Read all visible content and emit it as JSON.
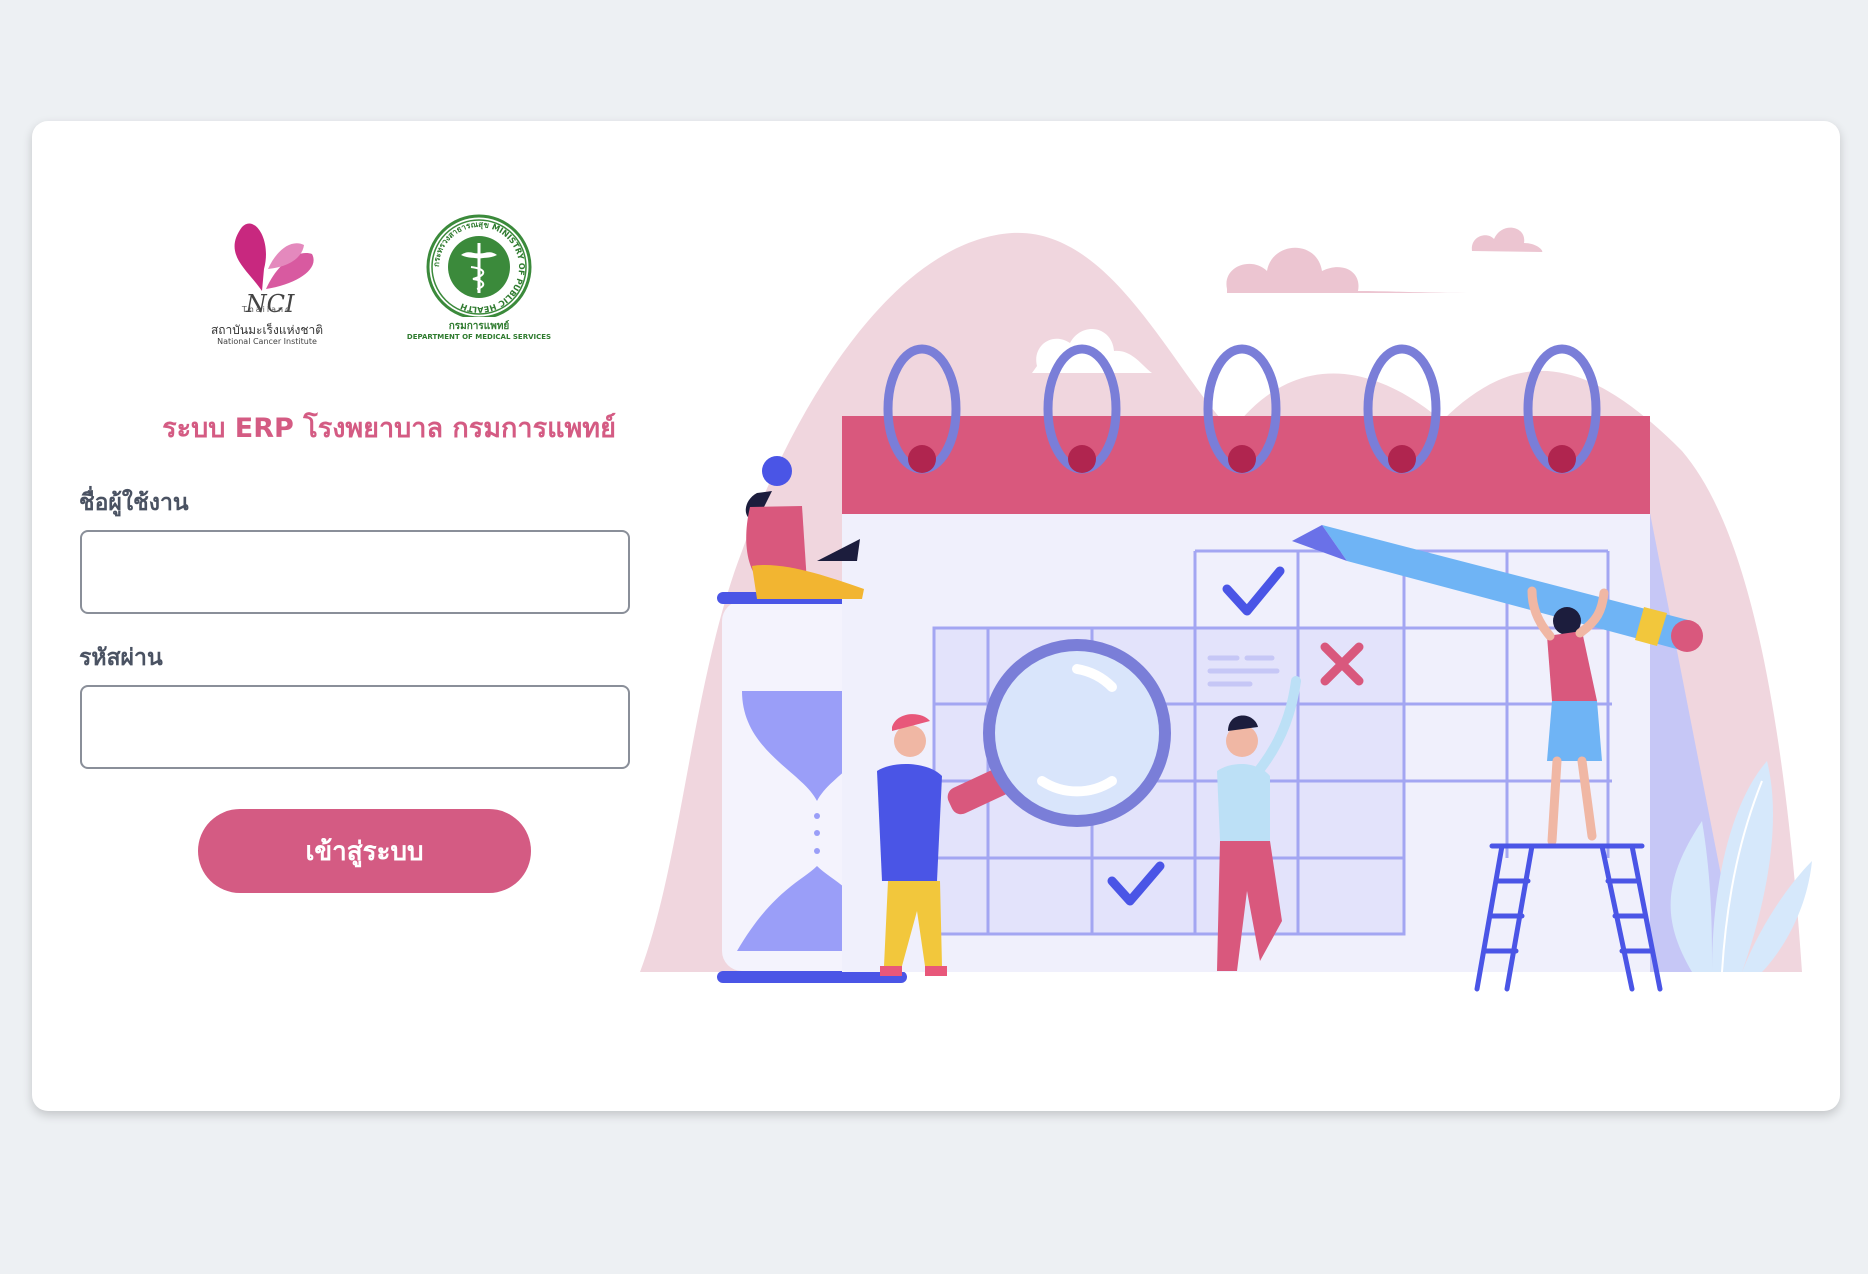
{
  "logos": {
    "nci": {
      "mark_text": "NCI",
      "sub_text": "Thailand",
      "caption_th": "สถาบันมะเร็งแห่งชาติ",
      "caption_en": "National Cancer Institute"
    },
    "dms": {
      "ring_text": "กระทรวงสาธารณสุข MINISTRY OF PUBLIC HEALTH",
      "caption_th": "กรมการแพทย์",
      "caption_en": "DEPARTMENT OF MEDICAL SERVICES"
    }
  },
  "login": {
    "title": "ระบบ ERP โรงพยาบาล กรมการแพทย์",
    "username_label": "ชื่อผู้ใช้งาน",
    "username_value": "",
    "password_label": "รหัสผ่าน",
    "password_value": "",
    "submit_label": "เข้าสู่ระบบ"
  },
  "colors": {
    "page_background": "#edf0f3",
    "card_background": "#ffffff",
    "accent_pink": "#d45b83",
    "label_gray": "#4a5262",
    "input_border": "#8a8f99",
    "illustration_indigo": "#4a55e6",
    "illustration_lavender": "#c6c7f6",
    "illustration_blush": "#f0d6de"
  },
  "illustration": {
    "subject": "calendar-planning-team-illustration"
  }
}
